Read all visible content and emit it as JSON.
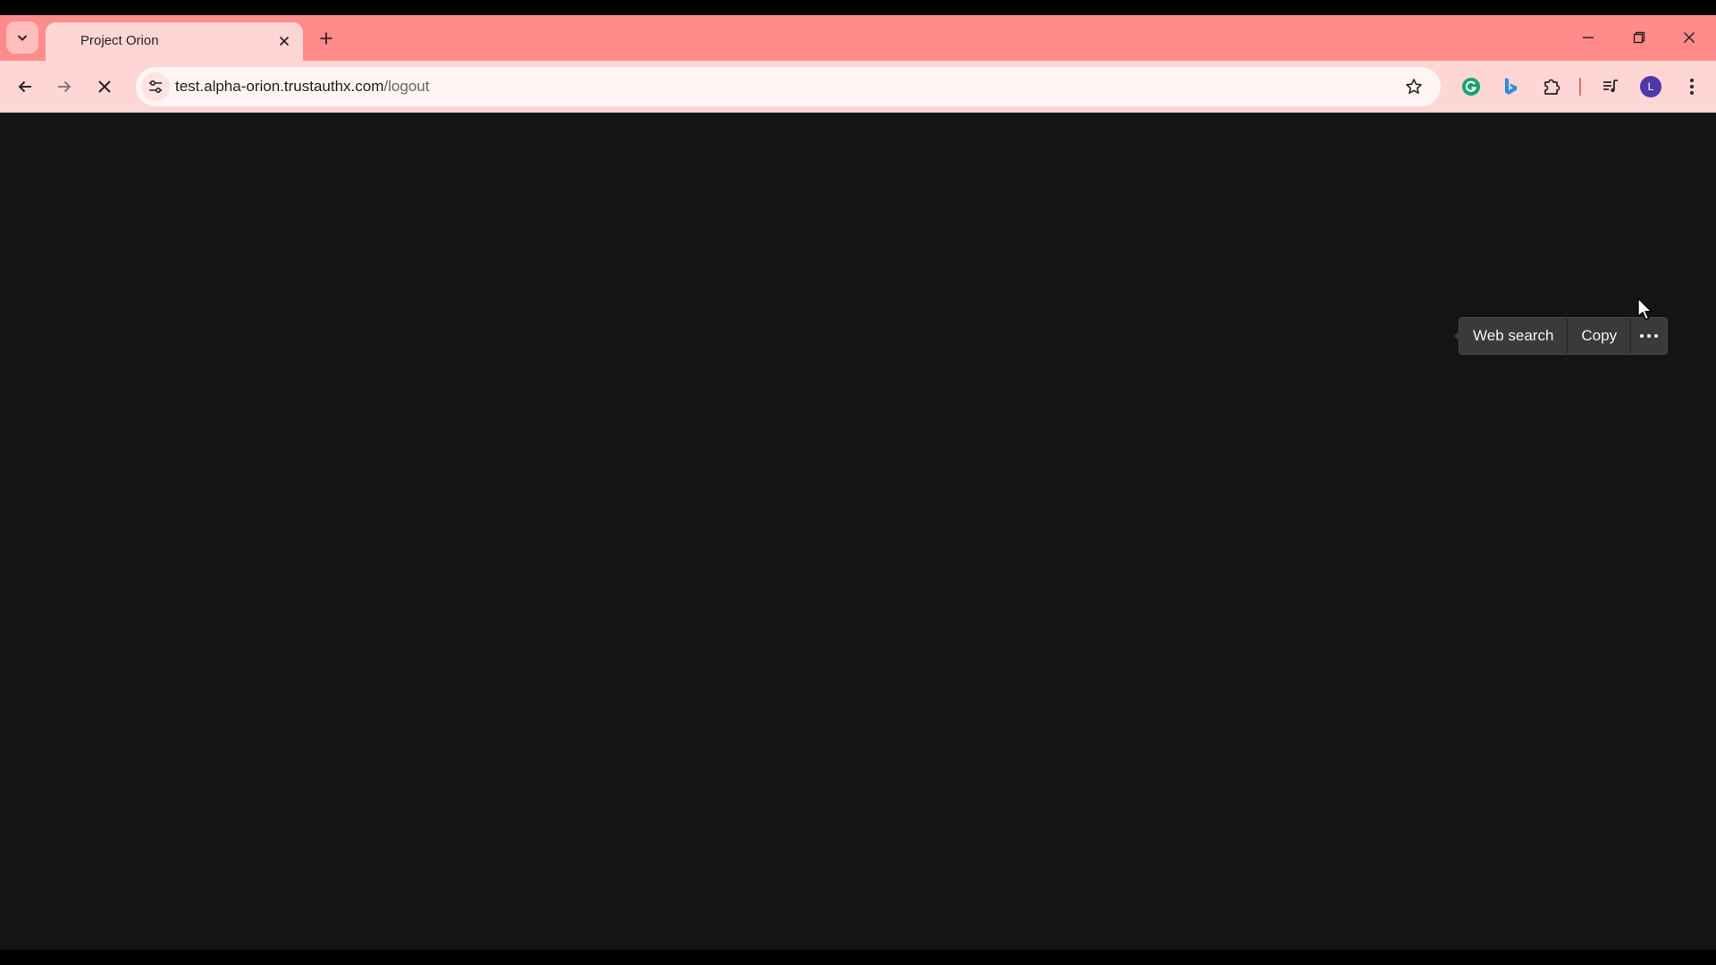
{
  "tab": {
    "title": "Project Orion"
  },
  "address_bar": {
    "host": "test.alpha-orion.trustauthx.com",
    "path": "/logout"
  },
  "profile": {
    "initial": "L"
  },
  "selection_menu": {
    "items": [
      "Web search",
      "Copy"
    ],
    "more_icon": "more-horizontal-icon"
  },
  "colors": {
    "tabstrip": "#ff8b8b",
    "toolbar": "#ffd6d6",
    "page_background": "#151517",
    "avatar": "#4d3aa8"
  }
}
